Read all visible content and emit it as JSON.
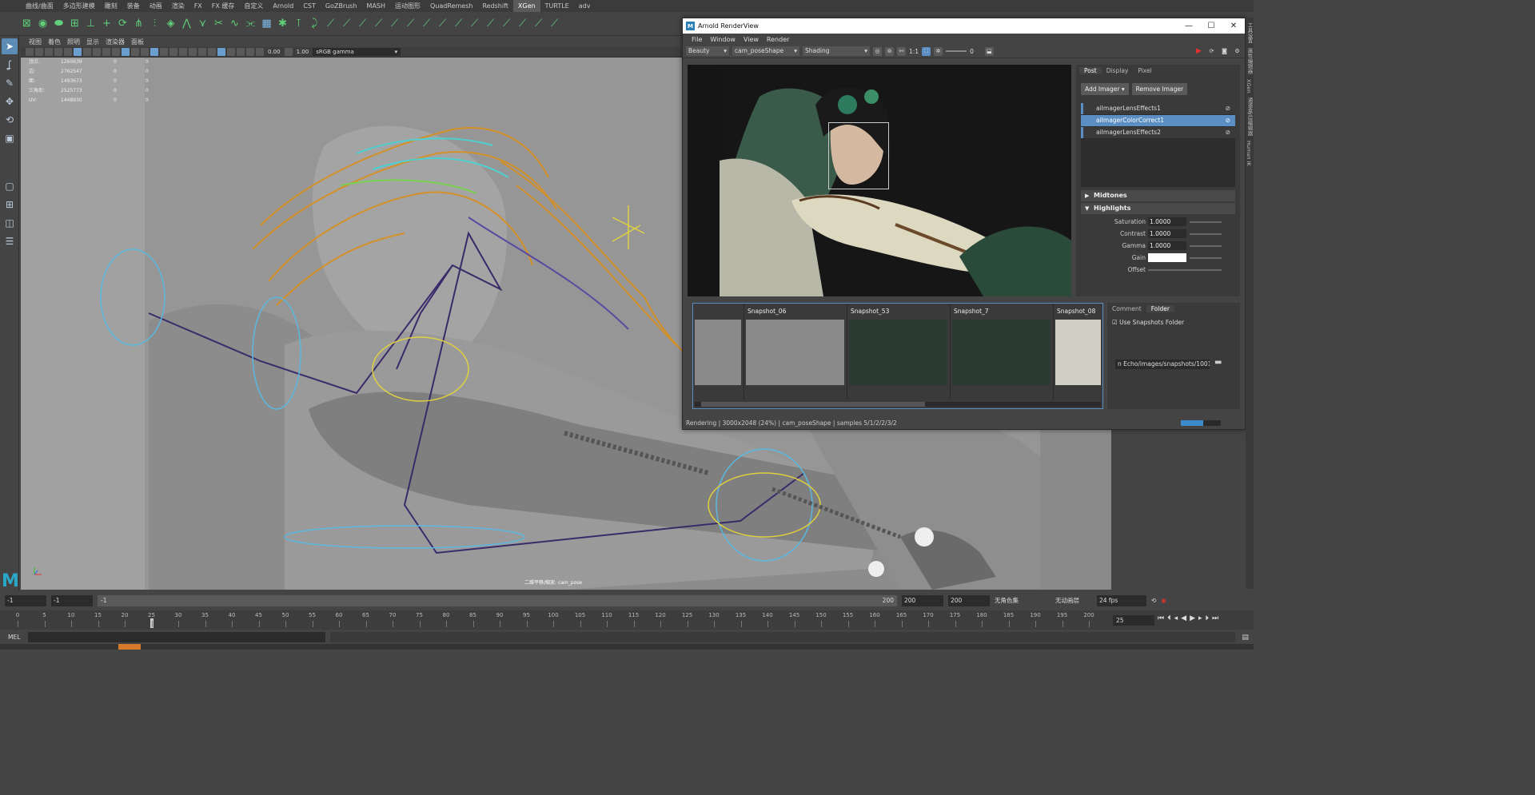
{
  "shelf": {
    "tabs": [
      "曲线/曲面",
      "多边形建模",
      "雕刻",
      "装备",
      "动画",
      "渲染",
      "FX",
      "FX 缓存",
      "自定义",
      "Arnold",
      "CST",
      "GoZBrush",
      "MASH",
      "运动图形",
      "QuadRemesh",
      "Redshift",
      "XGen",
      "TURTLE",
      "adv"
    ],
    "active_tab": "XGen"
  },
  "panel_menu": [
    "视图",
    "着色",
    "照明",
    "显示",
    "渲染器",
    "面板"
  ],
  "panel_toolbar": {
    "exposure": "0.00",
    "gamma": "1.00",
    "color_space": "sRGB gamma"
  },
  "hud": {
    "rows": [
      {
        "key": "顶点:",
        "v1": "1260639",
        "v2": "0",
        "v3": "0"
      },
      {
        "key": "边:",
        "v1": "2762547",
        "v2": "0",
        "v3": "0"
      },
      {
        "key": "面:",
        "v1": "1493673",
        "v2": "0",
        "v3": "0"
      },
      {
        "key": "三角形:",
        "v1": "2525773",
        "v2": "0",
        "v3": "0"
      },
      {
        "key": "UV:",
        "v1": "1448930",
        "v2": "0",
        "v3": "0"
      }
    ]
  },
  "viewport": {
    "camera_label": "二维平移/缩放: cam_pose"
  },
  "arnold": {
    "title": "Arnold RenderView",
    "menu": [
      "File",
      "Window",
      "View",
      "Render"
    ],
    "toolbar": {
      "aov": "Beauty",
      "camera": "cam_poseShape",
      "mode": "Shading",
      "ratio": "1:1",
      "value": "0"
    },
    "side_tabs": [
      "Post",
      "Display",
      "Pixel"
    ],
    "side_active": "Post",
    "buttons": {
      "add": "Add Imager",
      "remove": "Remove Imager"
    },
    "imagers": [
      {
        "name": "aiImagerLensEffects1",
        "selected": false
      },
      {
        "name": "aiImagerColorCorrect1",
        "selected": true
      },
      {
        "name": "aiImagerLensEffects2",
        "selected": false
      }
    ],
    "sections": {
      "midtones": "Midtones",
      "highlights": "Highlights"
    },
    "params": [
      {
        "label": "Saturation",
        "value": "1.0000"
      },
      {
        "label": "Contrast",
        "value": "1.0000"
      },
      {
        "label": "Gamma",
        "value": "1.0000"
      },
      {
        "label": "Gain",
        "value": ""
      },
      {
        "label": "Offset",
        "value": ""
      }
    ],
    "snapshots": [
      "",
      "Snapshot_06",
      "Snapshot_53",
      "Snapshot_7",
      "Snapshot_08"
    ],
    "snap_tabs": [
      "Comment",
      "Folder"
    ],
    "snap_active": "Folder",
    "use_folder_label": "Use Snapshots Folder",
    "folder_path": "n Echo/images/snapshots/1001",
    "status": "Rendering | 3000x2048 (24%) | cam_poseShape | samples 5/1/2/2/3/2",
    "progress": 0.55
  },
  "right_tabs": [
    "工具设置",
    "属性编辑器",
    "XGen",
    "通道盒/层编辑器",
    "Human IK"
  ],
  "range_bar": {
    "start": "-1",
    "start2": "-1",
    "slider_start": "-1",
    "slider_end": "200",
    "end": "200",
    "end2": "200",
    "char_set": "无角色集",
    "anim_layer": "无动画层",
    "fps": "24 fps"
  },
  "timeline": {
    "ticks": [
      "0",
      "5",
      "10",
      "15",
      "20",
      "25",
      "30",
      "35",
      "40",
      "45",
      "50",
      "55",
      "60",
      "65",
      "70",
      "75",
      "80",
      "85",
      "90",
      "95",
      "100",
      "105",
      "110",
      "115",
      "120",
      "125",
      "130",
      "135",
      "140",
      "145",
      "150",
      "155",
      "160",
      "165",
      "170",
      "175",
      "180",
      "185",
      "190",
      "195",
      "200"
    ],
    "current_frame": "25",
    "frame_field": "25"
  },
  "command": {
    "label": "MEL"
  },
  "colors": {
    "accent": "#5b8ec3",
    "shelf_green": "#5fcf7a",
    "maya_logo": "#2aa8c9",
    "record_red": "#e03030"
  }
}
